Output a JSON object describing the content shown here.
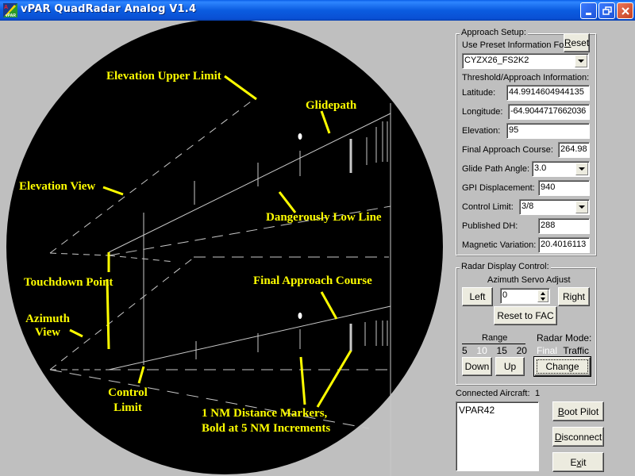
{
  "window": {
    "title": "vPAR QuadRadar Analog V1.4",
    "app_icon": "vpar-app-icon",
    "controls": {
      "minimize": "minimize-icon",
      "restore": "restore-icon",
      "close": "close-icon"
    }
  },
  "radar": {
    "background_color": "#000000",
    "line_color": "#c8c8c8",
    "annotation_color": "#ffff00",
    "annotations": {
      "elevation_upper_limit": "Elevation Upper Limit",
      "glidepath": "Glidepath",
      "elevation_view": "Elevation View",
      "dangerously_low_line": "Dangerously Low Line",
      "touchdown_point": "Touchdown Point",
      "final_approach_course": "Final Approach Course",
      "azimuth_view_line1": "Azimuth",
      "azimuth_view_line2": "View",
      "control_limit_line1": "Control",
      "control_limit_line2": "Limit",
      "distance_markers_line1": "1 NM Distance Markers,",
      "distance_markers_line2": "Bold at 5 NM Increments"
    }
  },
  "approach_setup": {
    "title": "Approach Setup:",
    "preset_label": "Use Preset Information For:",
    "reset_button": {
      "mnemonic": "R",
      "rest": "eset"
    },
    "preset_value": "CYZX26_FS2K2",
    "threshold_heading": "Threshold/Approach Information:",
    "fields": {
      "latitude": {
        "label": "Latitude:",
        "value": "44.9914604944135"
      },
      "longitude": {
        "label": "Longitude:",
        "value": "-64.9044717662036"
      },
      "elevation": {
        "label": "Elevation:",
        "value": "95"
      },
      "final_approach_course": {
        "label": "Final Approach Course:",
        "value": "264.98"
      },
      "glide_path_angle": {
        "label": "Glide Path Angle:",
        "value": "3.0"
      },
      "gpi_displacement": {
        "label": "GPI Displacement:",
        "value": "940"
      },
      "control_limit": {
        "label": "Control Limit:",
        "value": "3/8"
      },
      "published_dh": {
        "label": "Published DH:",
        "value": "288"
      },
      "magnetic_variation": {
        "label": "Magnetic Variation:",
        "value": "20.4016113"
      }
    }
  },
  "radar_display_control": {
    "title": "Radar Display Control:",
    "azimuth_servo_label": "Azimuth Servo Adjust",
    "left_button": "Left",
    "right_button": "Right",
    "servo_value": "0",
    "reset_fac_button": "Reset to FAC",
    "range_label": "Range",
    "range_options": [
      "5",
      "10",
      "15",
      "20"
    ],
    "range_selected": "10",
    "down_button": "Down",
    "up_button": "Up",
    "radar_mode_label": "Radar Mode:",
    "mode_options": [
      "Final",
      "Traffic"
    ],
    "mode_selected": "Final",
    "change_button": "Change"
  },
  "connected": {
    "label": "Connected Aircraft:",
    "count": "1",
    "aircraft": [
      "VPAR42"
    ],
    "boot_button": {
      "mnemonic": "B",
      "rest": "oot Pilot"
    },
    "disconnect_button": {
      "mnemonic": "D",
      "rest": "isconnect"
    },
    "exit_button": {
      "pre": "E",
      "mnemonic": "x",
      "rest": "it"
    }
  }
}
